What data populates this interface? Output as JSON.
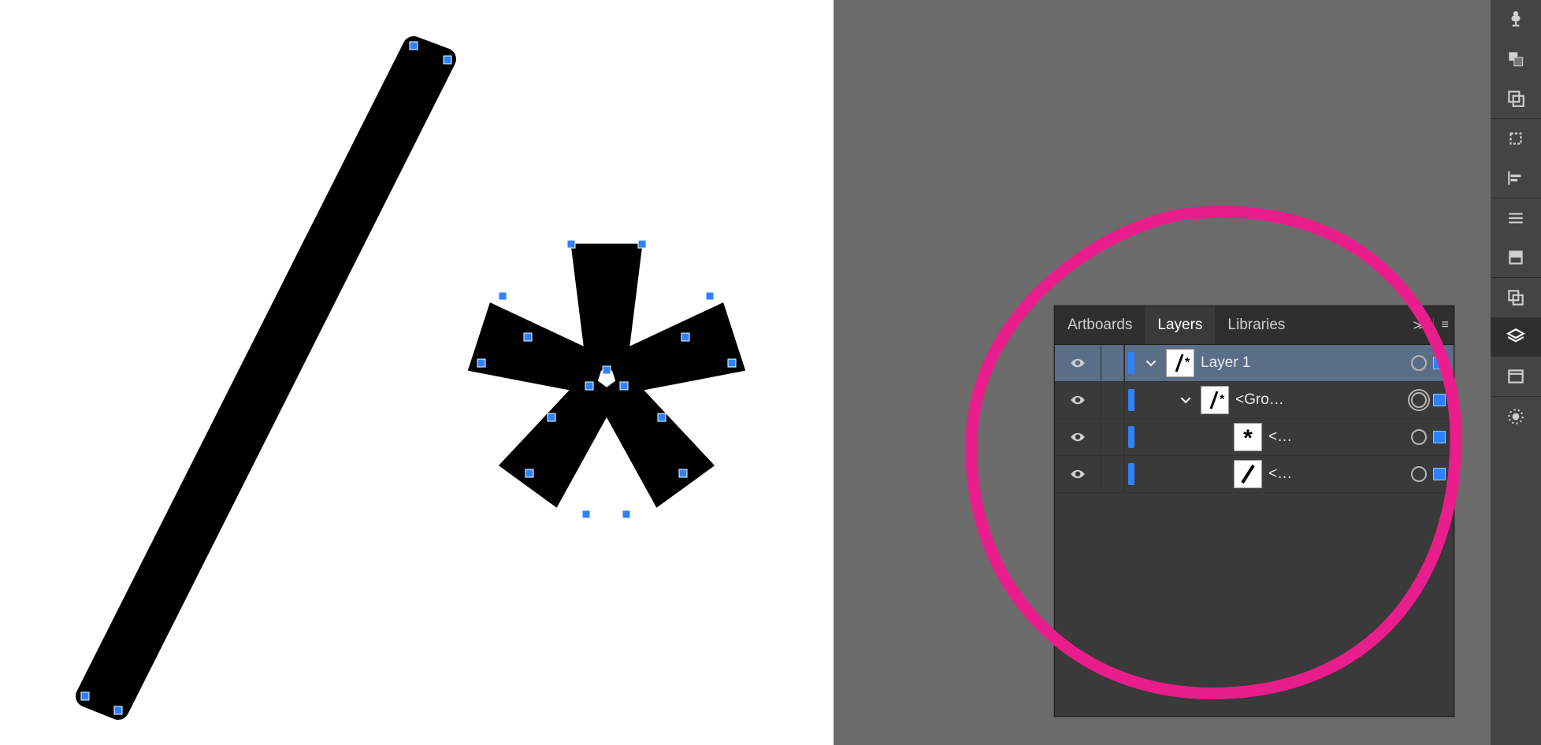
{
  "panel": {
    "tabs": {
      "artboards": "Artboards",
      "layers": "Layers",
      "libraries": "Libraries"
    },
    "active_tab": "Layers",
    "rows": [
      {
        "label": "Layer 1"
      },
      {
        "label": "<Gro…"
      },
      {
        "label": "<…"
      },
      {
        "label": "<…"
      }
    ]
  },
  "sidebar": {
    "icons": [
      "club-icon",
      "shapes-icon",
      "artboards-icon",
      "crop-icon",
      "align-left-icon",
      "list-icon",
      "swatch-icon",
      "overlap-icon",
      "layers-icon",
      "library-icon",
      "blob-icon"
    ],
    "active": "layers-icon"
  }
}
